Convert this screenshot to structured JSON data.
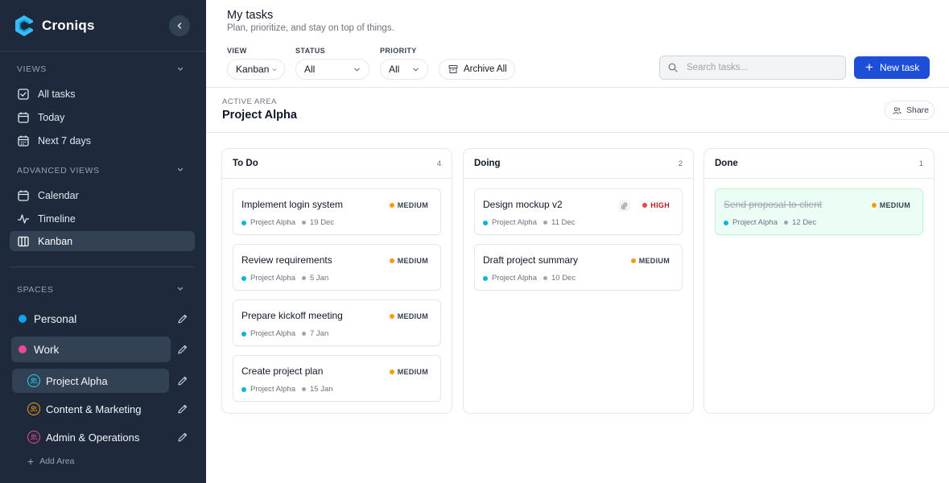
{
  "app": {
    "name": "Croniqs"
  },
  "colors": {
    "sidebar_bg": "#1e293b",
    "accent": "#1d4ed8",
    "personal": "#0ea5e9",
    "work": "#ec4899",
    "medium": "#f59e0b",
    "high": "#ef4444",
    "project": "#06b6d4"
  },
  "sidebar": {
    "views_label": "VIEWS",
    "views": [
      {
        "label": "All tasks",
        "icon": "checkbox-icon"
      },
      {
        "label": "Today",
        "icon": "calendar-icon"
      },
      {
        "label": "Next 7 days",
        "icon": "calendar-week-icon"
      }
    ],
    "advanced_label": "ADVANCED VIEWS",
    "advanced": [
      {
        "label": "Calendar",
        "icon": "calendar-icon"
      },
      {
        "label": "Timeline",
        "icon": "pulse-icon"
      },
      {
        "label": "Kanban",
        "icon": "kanban-icon",
        "active": true
      }
    ],
    "spaces_label": "SPACES",
    "spaces": [
      {
        "label": "Personal",
        "color": "#0ea5e9"
      },
      {
        "label": "Work",
        "color": "#ec4899",
        "active": true
      }
    ],
    "areas": [
      {
        "label": "Project Alpha",
        "color": "#22d3ee",
        "active": true
      },
      {
        "label": "Content & Marketing",
        "color": "#f59e0b"
      },
      {
        "label": "Admin & Operations",
        "color": "#ec4899"
      }
    ],
    "add_area_label": "Add Area"
  },
  "header": {
    "title": "My tasks",
    "subtitle": "Plan, prioritize, and stay on top of things.",
    "filters": [
      {
        "label": "VIEW",
        "value": "Kanban"
      },
      {
        "label": "STATUS",
        "value": "All"
      },
      {
        "label": "PRIORITY",
        "value": "All"
      }
    ],
    "archive_label": "Archive All",
    "search_placeholder": "Search tasks...",
    "new_task_label": "New task"
  },
  "area": {
    "label": "ACTIVE AREA",
    "title": "Project Alpha",
    "share_label": "Share"
  },
  "board": {
    "columns": [
      {
        "title": "To Do",
        "count": "4",
        "cards": [
          {
            "title": "Implement login system",
            "priority": "MEDIUM",
            "project": "Project Alpha",
            "date": "19 Dec"
          },
          {
            "title": "Review requirements",
            "priority": "MEDIUM",
            "project": "Project Alpha",
            "date": "5 Jan"
          },
          {
            "title": "Prepare kickoff meeting",
            "priority": "MEDIUM",
            "project": "Project Alpha",
            "date": "7 Jan"
          },
          {
            "title": "Create project plan",
            "priority": "MEDIUM",
            "project": "Project Alpha",
            "date": "15 Jan"
          }
        ]
      },
      {
        "title": "Doing",
        "count": "2",
        "cards": [
          {
            "title": "Design mockup v2",
            "priority": "HIGH",
            "project": "Project Alpha",
            "date": "11 Dec",
            "attachment": true
          },
          {
            "title": "Draft project summary",
            "priority": "MEDIUM",
            "project": "Project Alpha",
            "date": "10 Dec"
          }
        ]
      },
      {
        "title": "Done",
        "count": "1",
        "cards": [
          {
            "title": "Send proposal to client",
            "priority": "MEDIUM",
            "project": "Project Alpha",
            "date": "12 Dec",
            "completed": true
          }
        ]
      }
    ]
  }
}
